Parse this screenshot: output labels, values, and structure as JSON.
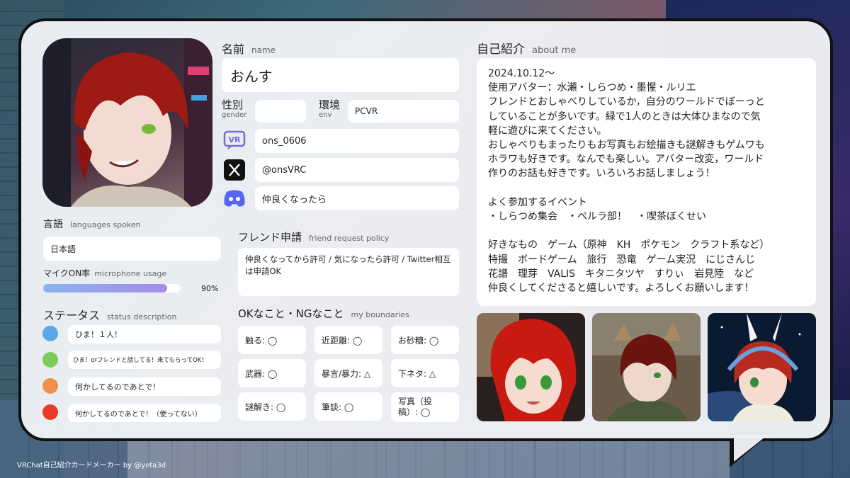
{
  "footer": "VRChat自己紹介カードメーカー by @yota3d",
  "name": {
    "label": "名前",
    "label_en": "name",
    "value": "おんす"
  },
  "gender": {
    "label": "性別",
    "label_en": "gender",
    "value": ""
  },
  "env": {
    "label": "環境",
    "label_en": "env",
    "value": "PCVR"
  },
  "vrchat": {
    "icon": "vr-icon",
    "value": "ons_0606"
  },
  "twitter": {
    "icon": "x-icon",
    "value": "@onsVRC"
  },
  "discord": {
    "icon": "discord-icon",
    "value": "仲良くなったら"
  },
  "languages": {
    "label": "言語",
    "label_en": "languages spoken",
    "value": "日本語"
  },
  "mic": {
    "label": "マイクON率",
    "label_en": "microphone usage",
    "percent": 90,
    "percent_text": "90%"
  },
  "status": {
    "label": "ステータス",
    "label_en": "status description",
    "items": [
      {
        "color": "#5aa8e6",
        "text": "ひま！１人！"
      },
      {
        "color": "#7ccc5a",
        "text": "ひま！orフレンドと話してる！来てもらってOK！"
      },
      {
        "color": "#f0904a",
        "text": "何かしてるのであとで！"
      },
      {
        "color": "#e83a2a",
        "text": "何かしてるのであとで！（使ってない）"
      }
    ]
  },
  "friend": {
    "label": "フレンド申請",
    "label_en": "friend request policy",
    "value": "仲良くなってから許可 / 気になったら許可 / Twitter相互は申請OK"
  },
  "boundaries": {
    "label": "OKなこと・NGなこと",
    "label_en": "my boundaries",
    "items": [
      "触る: ◯",
      "近距離: ◯",
      "お砂糖: ◯",
      "武器: ◯",
      "暴言/暴力: △",
      "下ネタ: △",
      "謎解き: ◯",
      "筆談: ◯",
      "写真（投稿）: ◯"
    ]
  },
  "about": {
    "label": "自己紹介",
    "label_en": "about me",
    "text": "2024.10.12〜\n使用アバター：水瀬・しらつめ・墨惺・ルリエ\nフレンドとおしゃべりしているか，自分のワールドでぼーっと\nしていることが多いです。緑で1人のときは大体ひまなので気\n軽に遊びに来てください。\nおしゃべりもまったりもお写真もお絵描きも謎解きもゲムワも\nホラワも好きです。なんでも楽しい。アバター改変，ワールド\n作りのお話も好きです。いろいろお話しましょう！\n\nよく参加するイベント\n・しらつめ集会　・ペルラ部！　・喫茶ぼくせい\n\n好きなもの　ゲーム（原神　KH　ポケモン　クラフト系など）\n特撮　ボードゲーム　旅行　恐竜　ゲーム実況　にじさんじ\n花譜　理芽　VALIS　キタニタツヤ　すりぃ　岩見陸　など\n仲良くしてくださると嬉しいです。よろしくお願いします！"
  }
}
